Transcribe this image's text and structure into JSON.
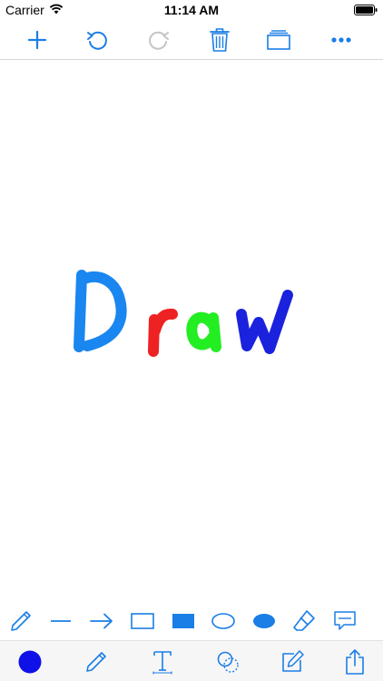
{
  "status_bar": {
    "carrier": "Carrier",
    "time": "11:14 AM"
  },
  "top_toolbar": {
    "icons": [
      "add-icon",
      "undo-icon",
      "redo-icon",
      "trash-icon",
      "layers-icon",
      "more-icon"
    ]
  },
  "canvas": {
    "strokes": [
      {
        "glyph": "D",
        "color": "#1a86f0"
      },
      {
        "glyph": "r",
        "color": "#ee2222"
      },
      {
        "glyph": "a",
        "color": "#22ee22"
      },
      {
        "glyph": "w",
        "color": "#1a22dd"
      }
    ]
  },
  "shape_toolbar": {
    "icons": [
      "pencil-icon",
      "line-icon",
      "arrow-icon",
      "rectangle-icon",
      "filled-rectangle-icon",
      "ellipse-icon",
      "filled-ellipse-icon",
      "eraser-icon",
      "speech-bubble-icon"
    ]
  },
  "bottom_toolbar": {
    "current_color": "#1010e8",
    "icons": [
      "color-swatch-icon",
      "pen-icon",
      "text-tool-icon",
      "shapes-icon",
      "edit-icon",
      "share-icon"
    ]
  },
  "colors": {
    "accent": "#1a7ee6",
    "disabled": "#c4c4c4"
  }
}
